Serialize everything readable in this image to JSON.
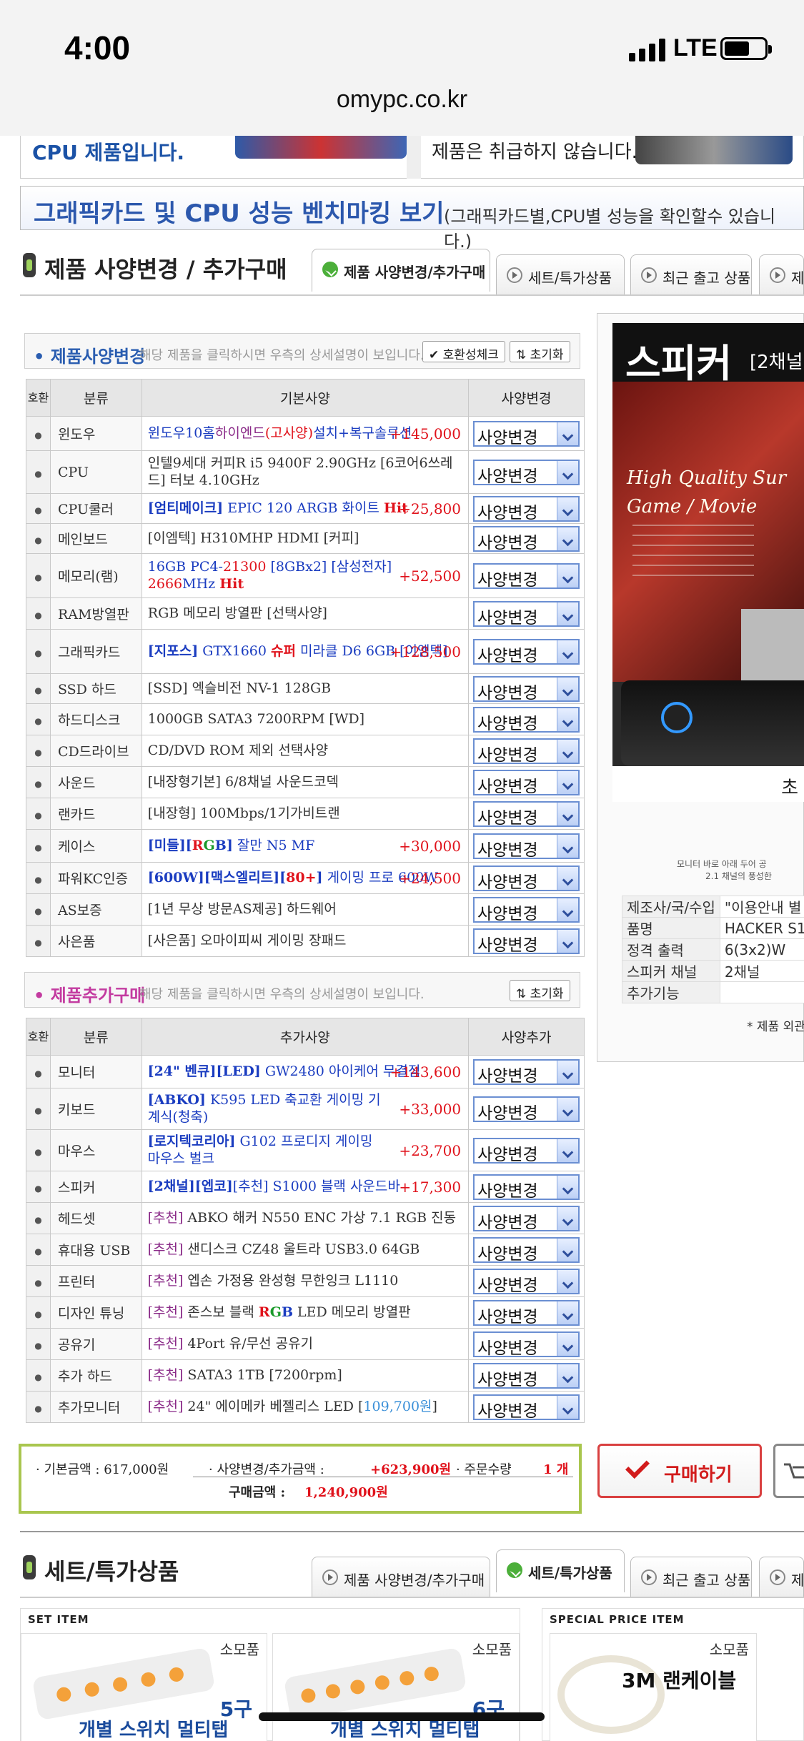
{
  "status": {
    "time": "4:00",
    "network": "LTE"
  },
  "browser": {
    "url": "omypc.co.kr"
  },
  "banner": {
    "left_text": "CPU 제품입니다.",
    "right_text": "제품은 취급하지 않습니다.",
    "bench_title": "그래픽카드 및 CPU 성능 벤치마킹 보기",
    "bench_sub": "(그래픽카드별,CPU별 성능을 확인할수 있습니다.)"
  },
  "section1": {
    "title": "제품 사양변경 / 추가구매",
    "tabs": [
      "제품 사양변경/추가구매",
      "세트/특가상품",
      "최근 출고 상품",
      "제"
    ]
  },
  "spec_panel": {
    "title": "제품사양변경",
    "desc": "해당 제품을 클릭하시면 우측의 상세설명이 보입니다.",
    "btn_compat": "✔ 호환성체크",
    "btn_reset": "⇅ 초기화",
    "headers": [
      "호환",
      "분류",
      "기본사양",
      "사양변경"
    ],
    "rows": [
      {
        "cat": "윈도우",
        "price": "+145,000"
      },
      {
        "cat": "CPU",
        "price": ""
      },
      {
        "cat": "CPU쿨러",
        "price": "+25,800"
      },
      {
        "cat": "메인보드",
        "price": ""
      },
      {
        "cat": "메모리(램)",
        "price": "+52,500"
      },
      {
        "cat": "RAM방열판",
        "price": ""
      },
      {
        "cat": "그래픽카드",
        "price": "+128,500"
      },
      {
        "cat": "SSD 하드",
        "price": ""
      },
      {
        "cat": "하드디스크",
        "price": ""
      },
      {
        "cat": "CD드라이브",
        "price": ""
      },
      {
        "cat": "사운드",
        "price": ""
      },
      {
        "cat": "랜카드",
        "price": ""
      },
      {
        "cat": "케이스",
        "price": "+30,000"
      },
      {
        "cat": "파워KC인증",
        "price": "+24,500"
      },
      {
        "cat": "AS보증",
        "price": ""
      },
      {
        "cat": "사은품",
        "price": ""
      }
    ],
    "specs": {
      "win": [
        "윈도우10홈",
        "하이엔드",
        "(고사양)",
        "설치+복구솔루션"
      ],
      "cpu": "인텔9세대 커피R i5 9400F 2.90GHz [6코어6쓰레드] 터보 4.10GHz",
      "cooler": [
        "[엄티메이크]",
        " EPIC 120 ARGB 화이트 ",
        "Hit"
      ],
      "mb": "[이엠텍] H310MHP HDMI [커피]",
      "mem": [
        "16GB PC4-",
        "21300",
        " [8GBx2] ",
        "[삼성전자]",
        "2666",
        "MHz ",
        "Hit"
      ],
      "ramsink": "RGB 메모리 방열판 [선택사양]",
      "gpu": [
        "[지포스]",
        " GTX1660 ",
        "슈퍼",
        " 미라클 D6 6GB ",
        "[이엠텍]"
      ],
      "ssd": "[SSD] 엑슬비전 NV-1 128GB",
      "hdd": "1000GB SATA3 7200RPM [WD]",
      "cd": "CD/DVD ROM 제외 선택사양",
      "sound": "[내장형기본] 6/8채널 사운드코덱",
      "lan": "[내장형] 100Mbps/1기가비트랜",
      "case": [
        "[미들]",
        "[",
        "R",
        "G",
        "B",
        "]",
        " 잘만 N5 MF"
      ],
      "psu": [
        "[600W]",
        "[맥스엘리트]",
        "[",
        "80+",
        "]",
        " 게이밍 프로 600W"
      ],
      "as": "[1년 무상 방문AS제공] 하드웨어",
      "gift": "[사은품] 오마이피씨 게이밍 장패드"
    },
    "select_label": "사양변경"
  },
  "add_panel": {
    "title": "제품추가구매",
    "desc": "해당 제품을 클릭하시면 우측의 상세설명이 보입니다.",
    "btn_reset": "⇅ 초기화",
    "headers": [
      "호환",
      "분류",
      "추가사양",
      "사양추가"
    ],
    "rows": [
      {
        "cat": "모니터",
        "price": "+143,600"
      },
      {
        "cat": "키보드",
        "price": "+33,000"
      },
      {
        "cat": "마우스",
        "price": "+23,700"
      },
      {
        "cat": "스피커",
        "price": "+17,300"
      },
      {
        "cat": "헤드셋",
        "price": ""
      },
      {
        "cat": "휴대용 USB",
        "price": ""
      },
      {
        "cat": "프린터",
        "price": ""
      },
      {
        "cat": "디자인 튜닝",
        "price": ""
      },
      {
        "cat": "공유기",
        "price": ""
      },
      {
        "cat": "추가 하드",
        "price": ""
      },
      {
        "cat": "추가모니터",
        "price": ""
      }
    ],
    "specs": {
      "monitor": [
        "[24\" 벤큐]",
        "[LED]",
        " GW2480 아이케어 무결점"
      ],
      "keyboard": [
        "[ABKO]",
        " K595 LED 축교환 게이밍 기계식(청축)"
      ],
      "mouse": [
        "[로지텍코리아]",
        " G102 프로디지 게이밍 마우스 벌크"
      ],
      "speaker": [
        "[2채널]",
        "[엡코]",
        "[추천]",
        " S1000 블랙 사운드바"
      ],
      "rec": "[추천]",
      "headset": " ABKO 해커 N550 ENC 가상 7.1 RGB 진동",
      "usb": " 샌디스크 CZ48 울트라 USB3.0 64GB",
      "printer": " 엡손 가정용 완성형 무한잉크 L1110",
      "tuning": [
        " 존스보 블랙 ",
        "R",
        "G",
        "B",
        " LED 메모리 방열판"
      ],
      "router": " 4Port 유/무선 공유기",
      "hdd": " SATA3 1TB [7200rpm]",
      "mon2": [
        " 24\" 에이메카 베젤리스 LED [",
        "109,700원",
        "]"
      ]
    },
    "select_label": "사양변경"
  },
  "product": {
    "header_title": "스피커",
    "header_sub": "[2채널",
    "photo_line1": "High Quality Sur",
    "photo_line2": "Game / Movie",
    "caption1": "모니터 바로 아래 두어 공",
    "caption2": "2.1 채널의 풍성한",
    "char": "초",
    "specs": [
      {
        "k": "제조사/국/수입",
        "v": "\"이용안내 별"
      },
      {
        "k": "품명",
        "v": "HACKER S1"
      },
      {
        "k": "정격 출력",
        "v": "6(3x2)W"
      },
      {
        "k": "스피커 채널",
        "v": "2채널"
      },
      {
        "k": "추가기능",
        "v": ""
      }
    ],
    "note": "* 제품 외관"
  },
  "total": {
    "base": "· 기본금액 : 617,000원",
    "change_label": "· 사양변경/추가금액 :",
    "change_value": "+623,900원",
    "qty_label": "· 주문수량",
    "qty_value": "1 개",
    "total_label": "구매금액 :",
    "total_value": "1,240,900원",
    "buy": "구매하기"
  },
  "section2": {
    "title": "세트/특가상품",
    "tabs": [
      "제품 사양변경/추가구매",
      "세트/특가상품",
      "최근 출고 상품",
      "제"
    ]
  },
  "set_items": {
    "set_label": "SET ITEM",
    "special_label": "SPECIAL PRICE ITEM",
    "items": [
      {
        "cat": "소모품",
        "num": "5구",
        "name": "개별 스위치 멀티탭"
      },
      {
        "cat": "소모품",
        "num": "6구",
        "name": "개별 스위치 멀티탭"
      },
      {
        "cat": "소모품",
        "name": "3M 랜케이블"
      }
    ]
  }
}
